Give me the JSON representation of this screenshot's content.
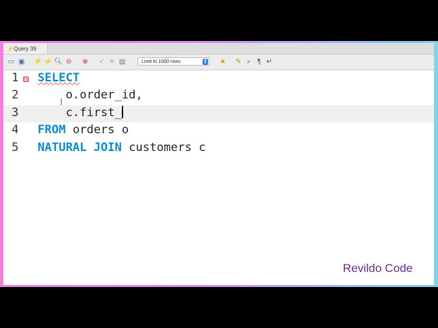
{
  "tab": {
    "title": "Query 39",
    "icon": "lightning-icon"
  },
  "toolbar": {
    "limit_select": "Limit to 1000 rows"
  },
  "editor": {
    "lines": [
      {
        "number": "1",
        "text": "SELECT"
      },
      {
        "number": "2",
        "text": "    o.order_id,"
      },
      {
        "number": "3",
        "text": "    c.first_"
      },
      {
        "number": "4",
        "kw": "FROM",
        "rest": " orders o"
      },
      {
        "number": "5",
        "kw": "NATURAL JOIN",
        "rest": " customers c"
      }
    ]
  },
  "watermark": "Revildo Code",
  "colors": {
    "keyword": "#0a8cc9",
    "frame_left": "#ee82e0",
    "frame_right": "#7fd3ee",
    "watermark": "#6a2e80"
  }
}
